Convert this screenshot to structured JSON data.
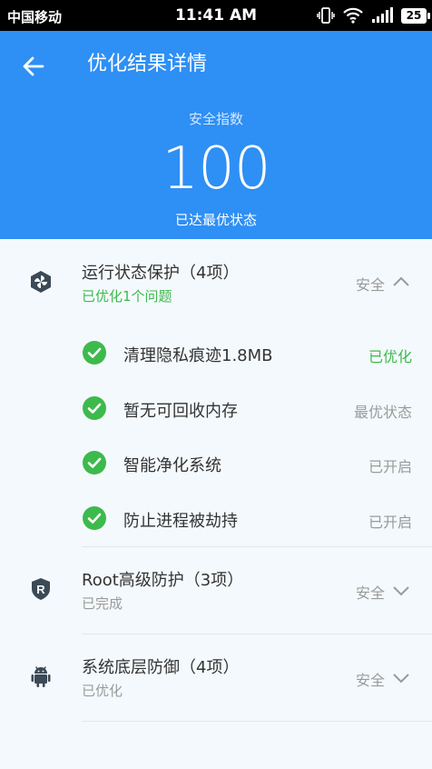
{
  "status_bar": {
    "carrier": "中国移动",
    "time": "11:41 AM",
    "battery": "25"
  },
  "header": {
    "title": "优化结果详情",
    "score_label": "安全指数",
    "score": "100",
    "score_status": "已达最优状态",
    "background_color": "#2e8ff5"
  },
  "sections": [
    {
      "title": "运行状态保护（4项）",
      "subtitle": "已优化1个问题",
      "state": "安全",
      "expanded": true,
      "icon": "shield-pinwheel-icon",
      "items": [
        {
          "label": "清理隐私痕迹1.8MB",
          "state": "已优化",
          "state_color": "#3dba4c"
        },
        {
          "label": "暂无可回收内存",
          "state": "最优状态"
        },
        {
          "label": "智能净化系统",
          "state": "已开启"
        },
        {
          "label": "防止进程被劫持",
          "state": "已开启"
        }
      ]
    },
    {
      "title": "Root高级防护（3项）",
      "subtitle": "已完成",
      "state": "安全",
      "expanded": false,
      "icon": "root-shield-icon"
    },
    {
      "title": "系统底层防御（4项）",
      "subtitle": "已优化",
      "state": "安全",
      "expanded": false,
      "icon": "android-icon"
    }
  ],
  "colors": {
    "accent_blue": "#2e8ff5",
    "success_green": "#3dba4c",
    "muted_text": "#9a9a9a"
  }
}
